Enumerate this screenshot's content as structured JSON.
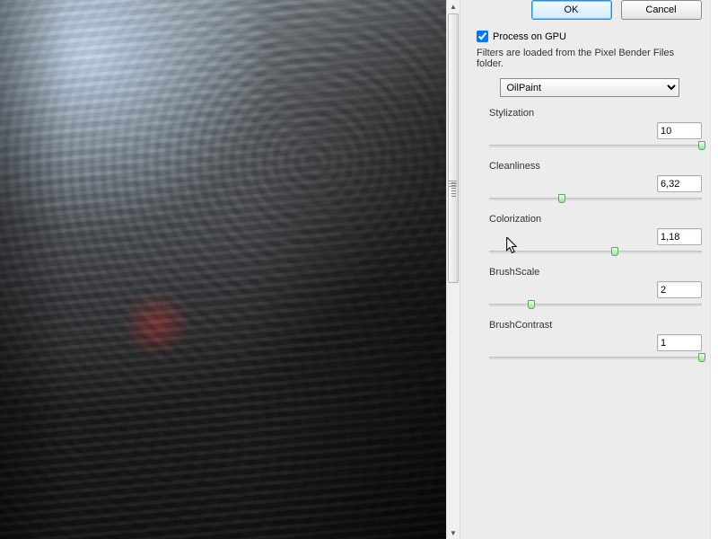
{
  "buttons": {
    "ok": "OK",
    "cancel": "Cancel"
  },
  "gpu": {
    "label": "Process on GPU",
    "checked": true
  },
  "info_text": "Filters are loaded from the Pixel Bender Files folder.",
  "filter": {
    "selected": "OilPaint"
  },
  "params": {
    "stylization": {
      "label": "Stylization",
      "value": "10",
      "pos": 100
    },
    "cleanliness": {
      "label": "Cleanliness",
      "value": "6,32",
      "pos": 34
    },
    "colorization": {
      "label": "Colorization",
      "value": "1,18",
      "pos": 59
    },
    "brushscale": {
      "label": "BrushScale",
      "value": "2",
      "pos": 20
    },
    "brushcontrast": {
      "label": "BrushContrast",
      "value": "1",
      "pos": 100
    }
  }
}
